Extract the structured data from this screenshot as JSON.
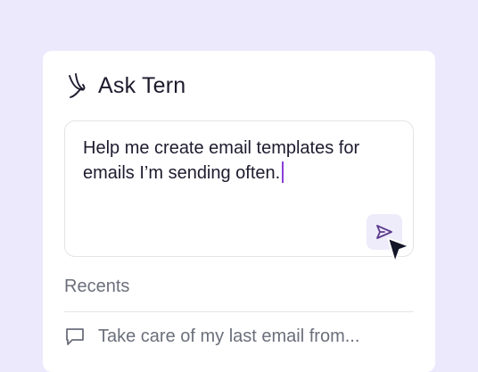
{
  "header": {
    "logo_icon": "tern-bird-logo-icon",
    "title": "Ask Tern"
  },
  "prompt": {
    "text": "Help me create email templates for emails I’m sending often.",
    "caret_color": "#8B3FD9"
  },
  "send_button": {
    "icon": "send-icon",
    "color": "#5B3A8C",
    "background": "#EEEBFB"
  },
  "recents": {
    "label": "Recents",
    "items": [
      {
        "icon": "chat-bubble-icon",
        "text": "Take care of my last email from..."
      }
    ]
  },
  "colors": {
    "page_background": "#ECE9FD",
    "card_background": "#FFFFFF",
    "text_primary": "#1E1B2E",
    "text_secondary": "#6B6F7B"
  }
}
